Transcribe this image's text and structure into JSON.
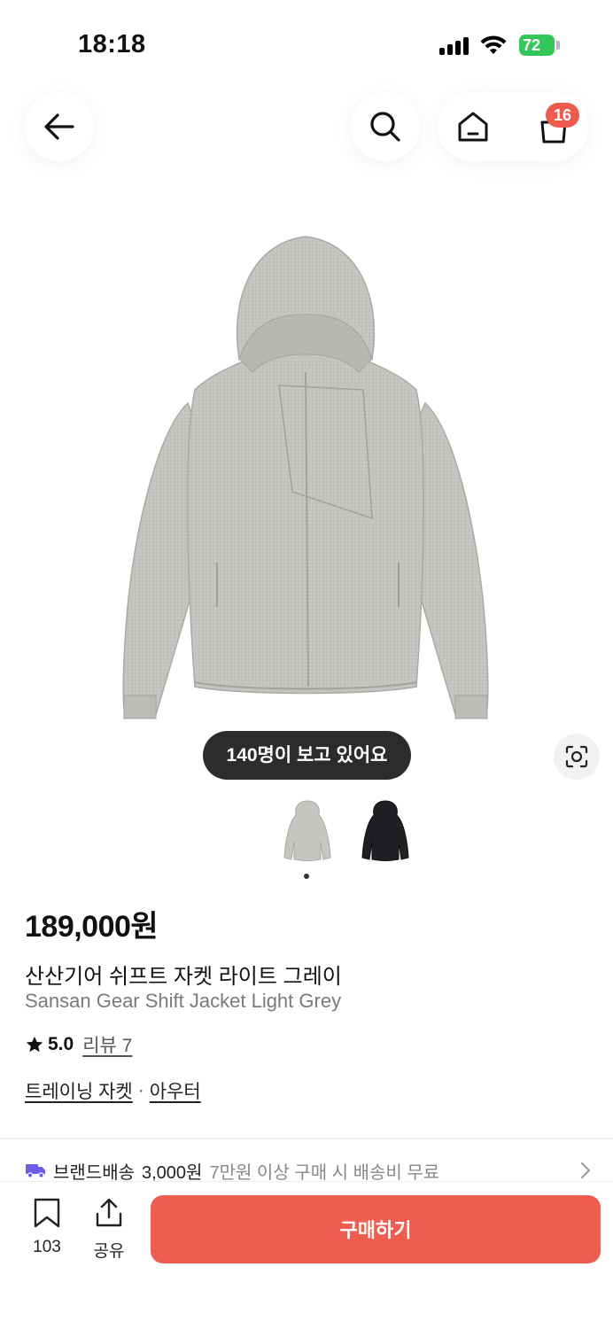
{
  "status_bar": {
    "time": "18:18",
    "battery": "72"
  },
  "header": {
    "cart_badge": "16"
  },
  "gallery": {
    "viewers_text": "140명이 보고 있어요",
    "current_index": 1,
    "thumbnail_count": 2
  },
  "product": {
    "price": "189,000원",
    "name_ko": "산산기어 쉬프트 자켓 라이트 그레이",
    "name_en": "Sansan Gear Shift Jacket Light Grey",
    "rating": "5.0",
    "review_label": "리뷰 7",
    "categories": [
      "트레이닝 자켓",
      "아우터"
    ],
    "category_separator": "·"
  },
  "shipping": {
    "label": "브랜드배송",
    "fee": "3,000원",
    "note": "7만원 이상 구매 시 배송비 무료"
  },
  "bottom_bar": {
    "save_count": "103",
    "share_label": "공유",
    "buy_label": "구매하기"
  },
  "colors": {
    "accent": "#ef5d4f",
    "badge": "#ef5a4d",
    "shipping_icon": "#6c5ce7",
    "battery": "#33c759"
  },
  "icons": [
    "back-arrow-icon",
    "search-icon",
    "home-icon",
    "cart-icon",
    "lens-icon",
    "star-icon",
    "truck-icon",
    "chevron-right-icon",
    "bookmark-icon",
    "share-icon"
  ]
}
